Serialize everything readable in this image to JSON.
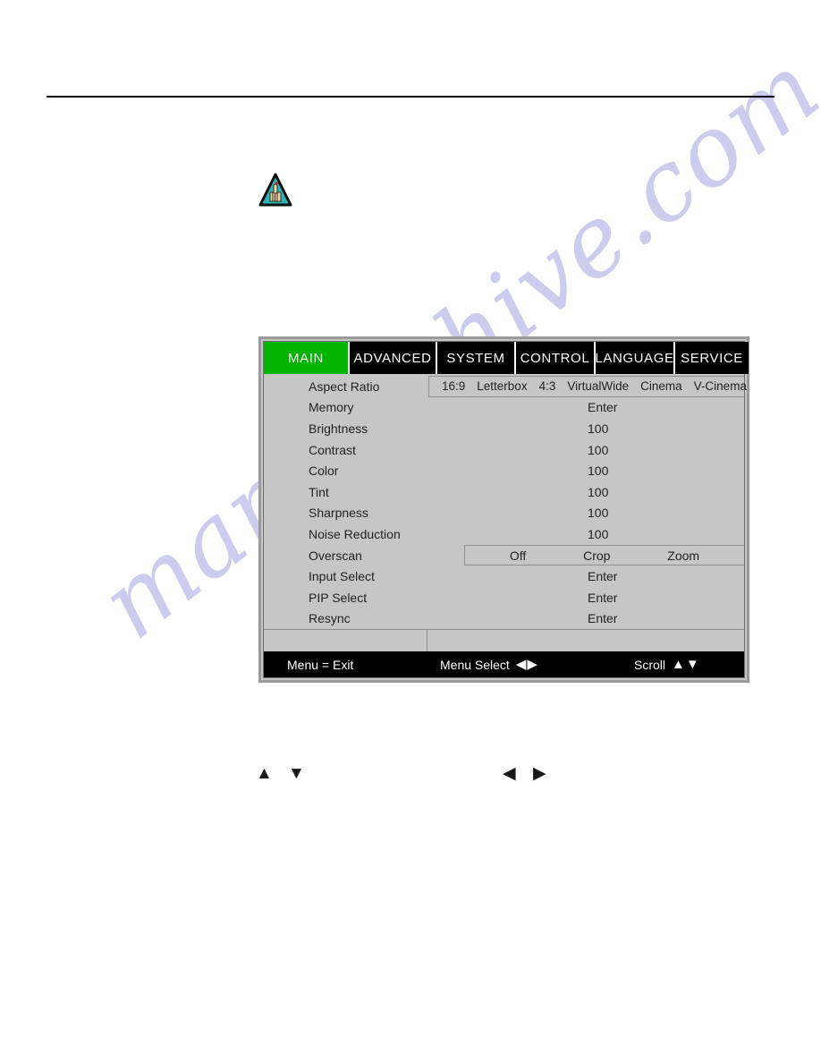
{
  "page": {
    "watermark_text": "manualshive.com",
    "rule_color": "#000000",
    "background": "#ffffff"
  },
  "note_icon": {
    "name": "note-hand-triangle-icon",
    "triangle_fill": "#2bb3b8",
    "border": "#111111"
  },
  "osd": {
    "panel_bg": "#c6c6c6",
    "accent_color": "#00b400",
    "tabs": [
      {
        "label": "MAIN",
        "active": true
      },
      {
        "label": "ADVANCED",
        "active": false
      },
      {
        "label": "SYSTEM",
        "active": false
      },
      {
        "label": "CONTROL",
        "active": false
      },
      {
        "label": "LANGUAGE",
        "active": false
      },
      {
        "label": "SERVICE",
        "active": false
      }
    ],
    "rows": [
      {
        "label": "Aspect Ratio",
        "type": "options",
        "options": [
          "16:9",
          "Letterbox",
          "4:3",
          "VirtualWide",
          "Cinema",
          "V-Cinema"
        ]
      },
      {
        "label": "Memory",
        "type": "value",
        "value": "Enter"
      },
      {
        "label": "Brightness",
        "type": "value",
        "value": "100"
      },
      {
        "label": "Contrast",
        "type": "value",
        "value": "100"
      },
      {
        "label": "Color",
        "type": "value",
        "value": "100"
      },
      {
        "label": "Tint",
        "type": "value",
        "value": "100"
      },
      {
        "label": "Sharpness",
        "type": "value",
        "value": "100"
      },
      {
        "label": "Noise Reduction",
        "type": "value",
        "value": "100"
      },
      {
        "label": "Overscan",
        "type": "options",
        "options": [
          "Off",
          "Crop",
          "Zoom"
        ]
      },
      {
        "label": "Input Select",
        "type": "value",
        "value": "Enter"
      },
      {
        "label": "PIP Select",
        "type": "value",
        "value": "Enter"
      },
      {
        "label": "Resync",
        "type": "value",
        "value": "Enter"
      }
    ],
    "footer": {
      "exit_label": "Menu = Exit",
      "select_label": "Menu Select",
      "select_left_arrow": "◀",
      "select_right_arrow": "▶",
      "scroll_label": "Scroll",
      "scroll_up_arrow": "▲",
      "scroll_down_arrow": "▼"
    }
  },
  "body_glyphs": {
    "up": "▲",
    "down": "▼",
    "left": "◀",
    "right": "▶"
  }
}
